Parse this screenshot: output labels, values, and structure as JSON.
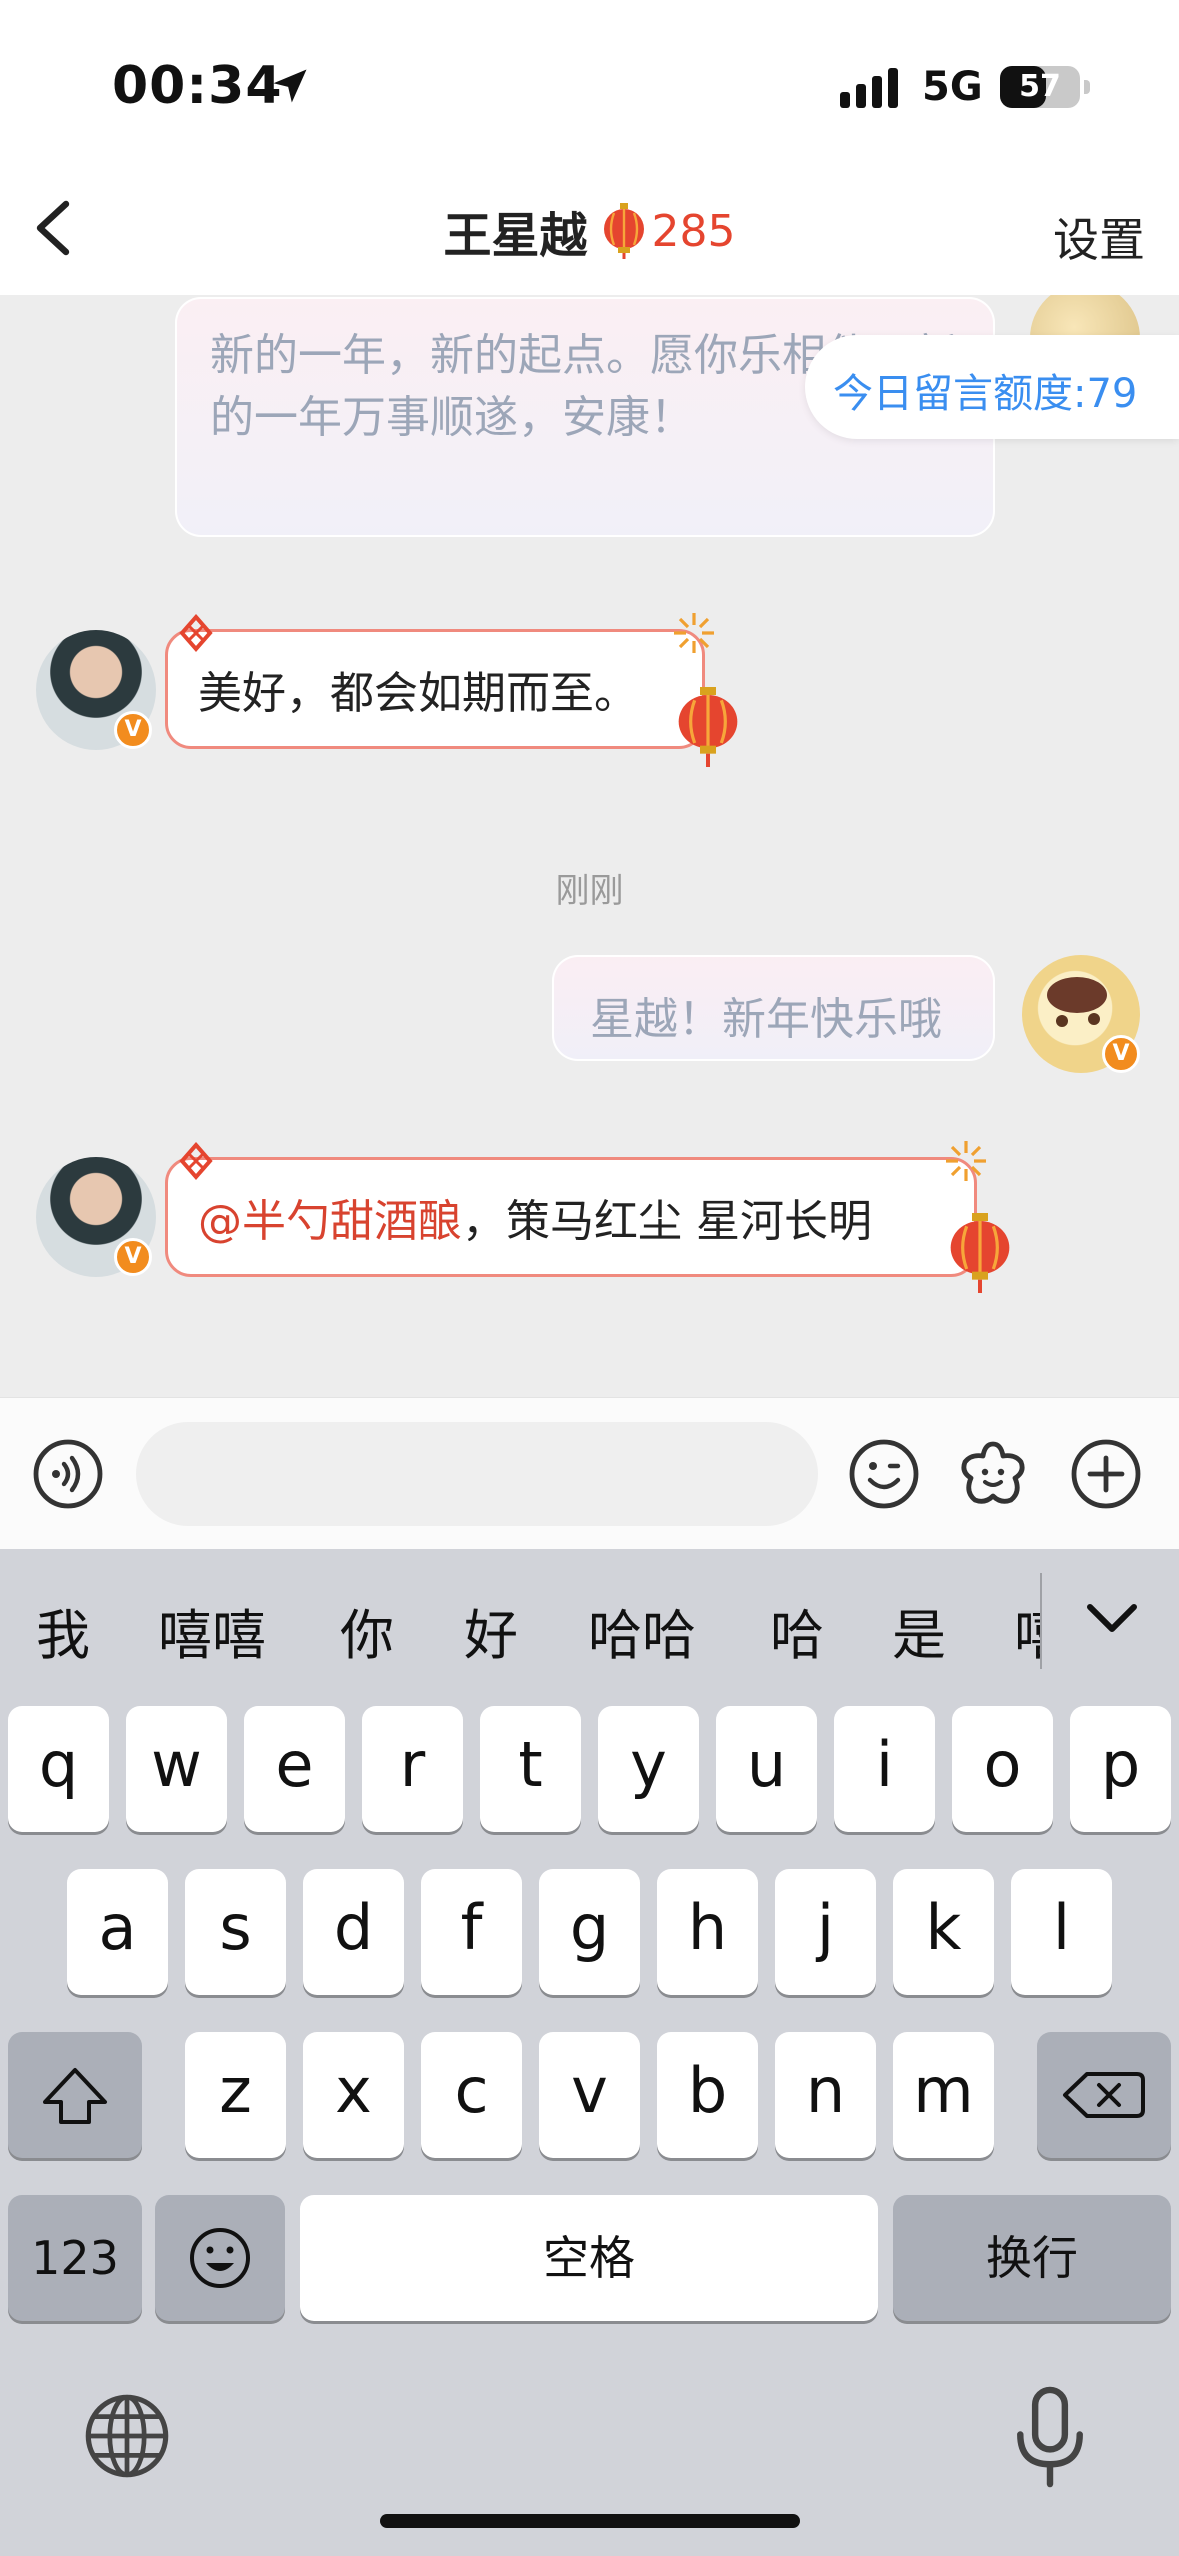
{
  "status_bar": {
    "time": "00:34",
    "network": "5G",
    "battery": "57",
    "battery_level": 0.57
  },
  "header": {
    "title": "王星越",
    "fans_count": "285",
    "settings_label": "设置"
  },
  "chat": {
    "quota_label": "今日留言额度:79",
    "old_message": {
      "text": "新的一年，新的起点。愿你乐相伴，新的一年万事顺遂，安康！"
    },
    "messages": [
      {
        "text": "美好，都会如期而至。"
      },
      {
        "mention": "@半勺甜酒酿",
        "text": "，策马红尘 星河长明"
      }
    ],
    "timestamp": "刚刚",
    "my_message": {
      "text": "星越！新年快乐哦"
    }
  },
  "input": {
    "value": "",
    "placeholder": ""
  },
  "keyboard": {
    "candidates": [
      "我",
      "嘻嘻",
      "你",
      "好",
      "哈哈",
      "哈",
      "是",
      "嘻"
    ],
    "rows": [
      [
        "q",
        "w",
        "e",
        "r",
        "t",
        "y",
        "u",
        "i",
        "o",
        "p"
      ],
      [
        "a",
        "s",
        "d",
        "f",
        "g",
        "h",
        "j",
        "k",
        "l"
      ],
      [
        "z",
        "x",
        "c",
        "v",
        "b",
        "n",
        "m"
      ]
    ],
    "numbers_label": "123",
    "space_label": "空格",
    "return_label": "换行"
  },
  "icons": {
    "back": "chevron-left-icon",
    "lantern": "lantern-icon",
    "voice": "voice-icon",
    "emoji": "emoji-icon",
    "sticker": "sticker-icon",
    "plus": "plus-icon",
    "shift": "shift-icon",
    "delete": "delete-icon",
    "globe": "globe-icon",
    "mic": "mic-icon"
  },
  "colors": {
    "accent_red": "#e5452f",
    "quota_blue": "#3a8ef0",
    "verified_orange": "#f28c1e"
  }
}
